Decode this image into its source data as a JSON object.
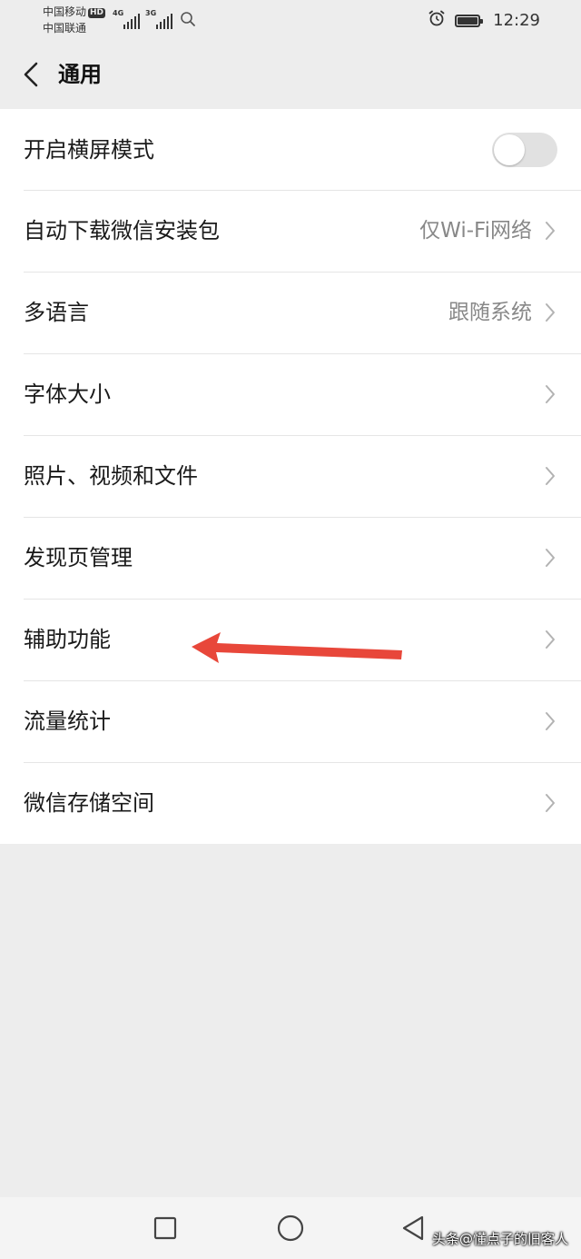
{
  "status_bar": {
    "carrier_1": "中国移动",
    "hd_badge": "HD",
    "carrier_2": "中国联通",
    "network_1": "4G",
    "network_2": "3G",
    "time": "12:29"
  },
  "header": {
    "title": "通用",
    "back_icon": "chevron-left-icon"
  },
  "settings": {
    "items": [
      {
        "label": "开启横屏模式",
        "value": "",
        "control": "toggle",
        "toggle_on": false
      },
      {
        "label": "自动下载微信安装包",
        "value": "仅Wi-Fi网络",
        "control": "chevron"
      },
      {
        "label": "多语言",
        "value": "跟随系统",
        "control": "chevron"
      },
      {
        "label": "字体大小",
        "value": "",
        "control": "chevron"
      },
      {
        "label": "照片、视频和文件",
        "value": "",
        "control": "chevron"
      },
      {
        "label": "发现页管理",
        "value": "",
        "control": "chevron"
      },
      {
        "label": "辅助功能",
        "value": "",
        "control": "chevron"
      },
      {
        "label": "流量统计",
        "value": "",
        "control": "chevron"
      },
      {
        "label": "微信存储空间",
        "value": "",
        "control": "chevron"
      }
    ]
  },
  "annotation": {
    "color": "#e8473a",
    "icon": "red-arrow-left-icon"
  },
  "nav_bar": {
    "recents_icon": "square-icon",
    "home_icon": "circle-icon",
    "back_icon": "triangle-back-icon"
  },
  "watermark": {
    "text": "头条@懂点子的旧客人"
  },
  "colors": {
    "background": "#ededed",
    "list_background": "#ffffff",
    "divider": "#e5e5e5",
    "secondary_text": "#888888",
    "toggle_off": "#e1e1e1"
  }
}
